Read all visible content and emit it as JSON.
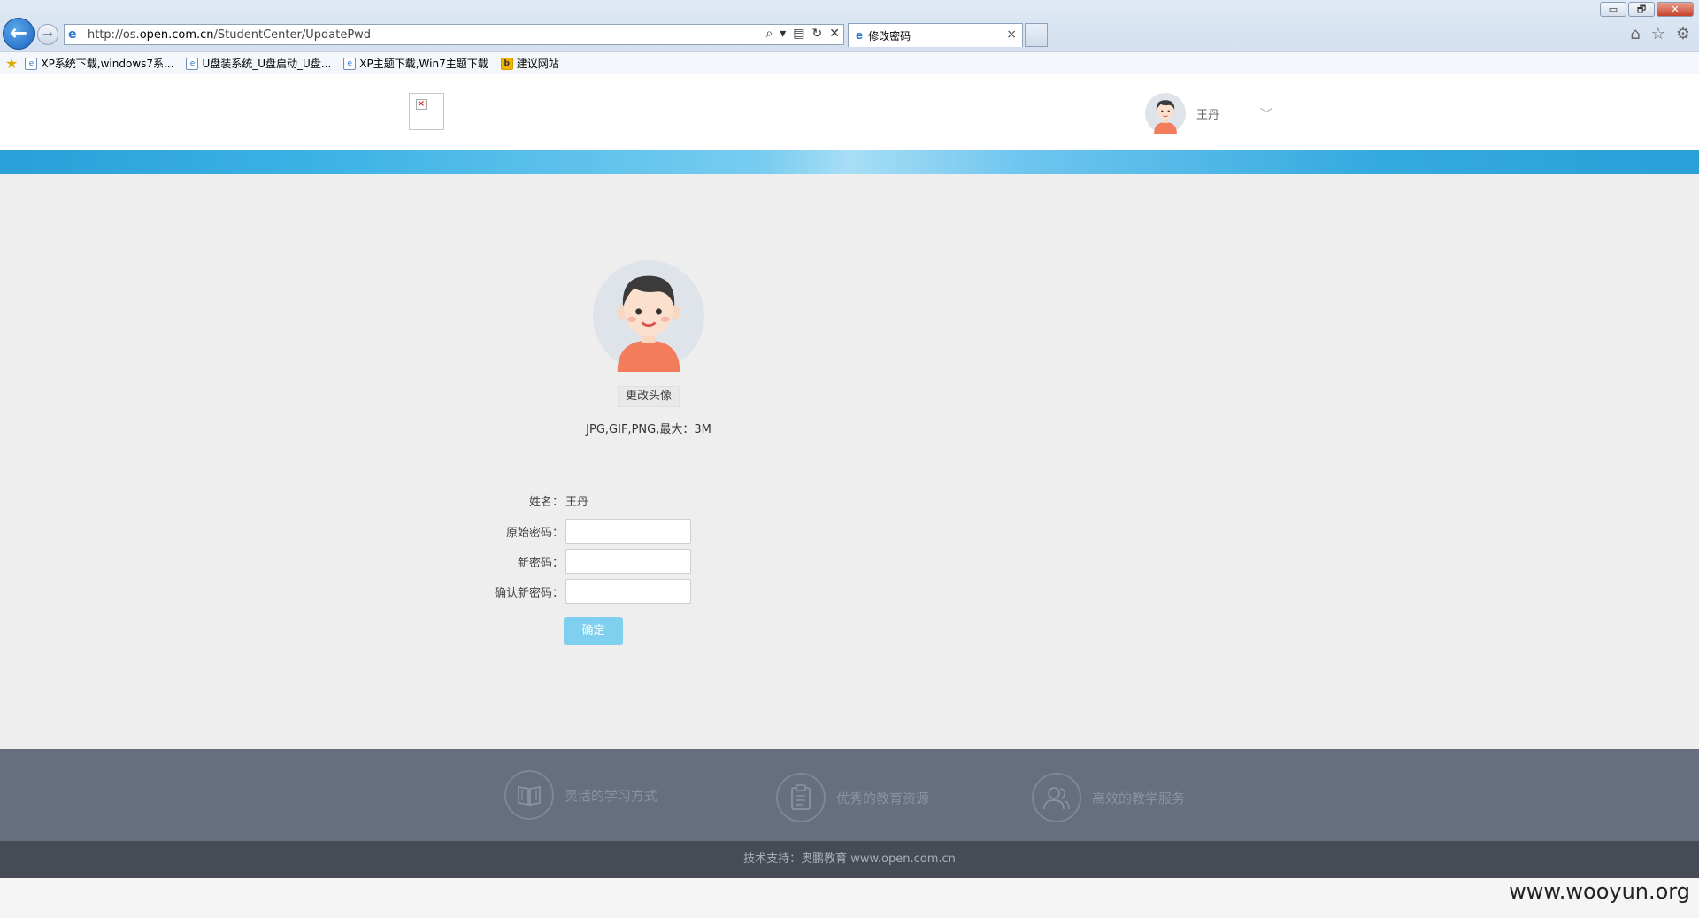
{
  "browser": {
    "url_prefix": "http://os.",
    "url_host": "open.com.cn",
    "url_path": "/StudentCenter/UpdatePwd",
    "tab_title": "修改密码",
    "window_buttons": {
      "minimize": "▭",
      "restore": "🗗",
      "close": "✕"
    },
    "favorites": [
      {
        "label": "XP系统下载,windows7系..."
      },
      {
        "label": "U盘装系统_U盘启动_U盘..."
      },
      {
        "label": "XP主题下载,Win7主题下载"
      },
      {
        "label": "建议网站"
      }
    ]
  },
  "header": {
    "user_name": "王丹"
  },
  "profile": {
    "change_avatar_label": "更改头像",
    "avatar_hint": "JPG,GIF,PNG,最大：3M"
  },
  "form": {
    "name_label": "姓名：",
    "name_value": "王丹",
    "old_password_label": "原始密码：",
    "new_password_label": "新密码：",
    "confirm_password_label": "确认新密码：",
    "submit_label": "确定"
  },
  "footer": {
    "features": [
      {
        "label": "灵活的学习方式",
        "icon": "book-icon"
      },
      {
        "label": "优秀的教育资源",
        "icon": "clipboard-icon"
      },
      {
        "label": "高效的教学服务",
        "icon": "users-icon"
      }
    ],
    "support_text": "技术支持：奥鹏教育 www.open.com.cn"
  },
  "watermark": "www.wooyun.org",
  "colors": {
    "accent_blue": "#3eb3e6",
    "submit_button": "#7fd0ef",
    "footer_top": "#676e7e",
    "footer_bottom": "#474b56",
    "main_bg": "#eeeeee"
  }
}
